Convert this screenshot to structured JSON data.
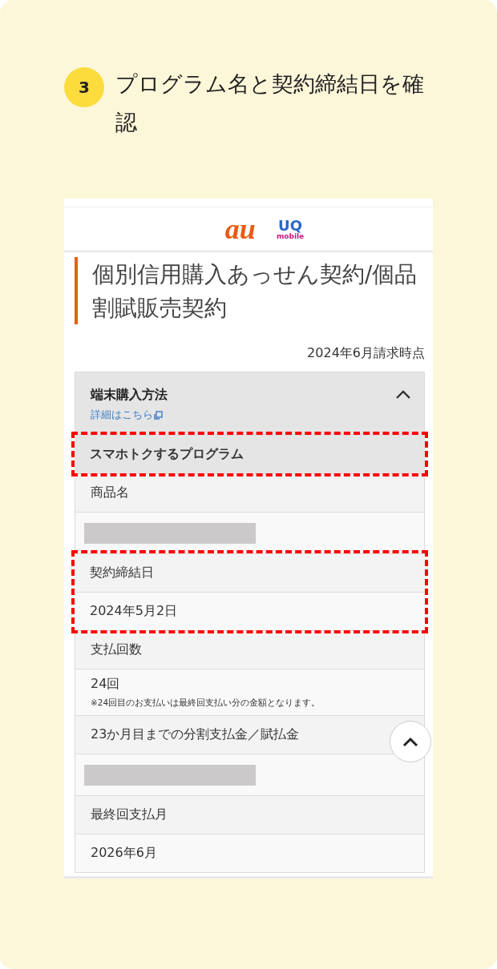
{
  "step": {
    "number": "3",
    "title": "プログラム名と契約締結日を確認"
  },
  "screen": {
    "logos": {
      "au": "au",
      "uq": "UQ",
      "uq_sub": "mobile"
    },
    "title": "個別信用購入あっせん契約/個品割賦販売契約",
    "as_of": "2024年6月請求時点",
    "section": {
      "title": "端末購入方法",
      "link": "詳細はこちら",
      "expanded": true
    },
    "rows": [
      {
        "kind": "subheader",
        "text": "スマホトクするプログラム",
        "highlighted": true
      },
      {
        "kind": "label",
        "text": "商品名",
        "highlighted": false
      },
      {
        "kind": "redacted",
        "highlighted": false
      },
      {
        "kind": "label",
        "text": "契約締結日",
        "highlighted": true
      },
      {
        "kind": "value",
        "text": "2024年5月2日",
        "highlighted": true
      },
      {
        "kind": "label",
        "text": "支払回数",
        "highlighted": false
      },
      {
        "kind": "value",
        "text": "24回",
        "note": "※24回目のお支払いは最終回支払い分の金額となります。",
        "highlighted": false
      },
      {
        "kind": "label",
        "text": "23か月目までの分割支払金／賦払金",
        "highlighted": false
      },
      {
        "kind": "redacted",
        "highlighted": false
      },
      {
        "kind": "label",
        "text": "最終回支払月",
        "highlighted": false
      },
      {
        "kind": "value",
        "text": "2026年6月",
        "highlighted": false
      }
    ]
  }
}
